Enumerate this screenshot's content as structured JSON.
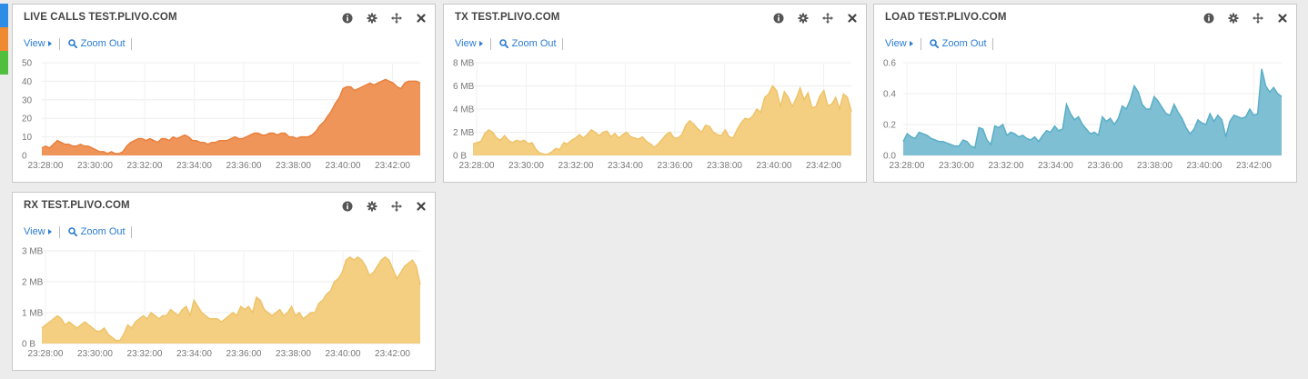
{
  "side_tabs": [
    {
      "name": "tab-blue",
      "color": "#2d8ce6"
    },
    {
      "name": "tab-orange",
      "color": "#f08a30"
    },
    {
      "name": "tab-green",
      "color": "#4fbf3d"
    }
  ],
  "toolbar": {
    "view_label": "View",
    "zoom_label": "Zoom Out"
  },
  "panels": {
    "live_calls": {
      "title": "LIVE CALLS TEST.PLIVO.COM",
      "chart_data": {
        "type": "area",
        "color": "#f0955a",
        "stroke": "#e8803c",
        "x_ticks": [
          "23:28:00",
          "23:30:00",
          "23:32:00",
          "23:34:00",
          "23:36:00",
          "23:38:00",
          "23:40:00",
          "23:42:00"
        ],
        "y_ticks": [
          "0",
          "10",
          "20",
          "30",
          "40",
          "50"
        ],
        "ylim": [
          0,
          50
        ],
        "values": [
          4,
          5,
          4,
          6,
          8,
          7,
          6,
          6,
          5,
          5,
          6,
          5,
          5,
          4,
          3,
          2,
          2,
          1,
          2,
          1,
          1,
          2,
          5,
          7,
          8,
          9,
          9,
          8,
          9,
          8,
          7,
          9,
          9,
          8,
          10,
          9,
          10,
          11,
          10,
          8,
          8,
          7,
          7,
          6,
          7,
          7,
          8,
          8,
          8,
          9,
          10,
          9,
          9,
          10,
          11,
          12,
          12,
          11,
          11,
          12,
          12,
          11,
          12,
          12,
          10,
          10,
          9,
          10,
          10,
          10,
          11,
          13,
          16,
          18,
          21,
          24,
          28,
          31,
          36,
          37,
          37,
          35,
          36,
          37,
          38,
          39,
          38,
          39,
          40,
          41,
          40,
          39,
          37,
          36,
          39,
          40,
          40,
          40,
          39
        ]
      }
    },
    "tx": {
      "title": "TX TEST.PLIVO.COM",
      "chart_data": {
        "type": "area",
        "color": "#f4cf82",
        "stroke": "#eec368",
        "x_ticks": [
          "23:28:00",
          "23:30:00",
          "23:32:00",
          "23:34:00",
          "23:36:00",
          "23:38:00",
          "23:40:00",
          "23:42:00"
        ],
        "y_ticks": [
          "0 B",
          "2 MB",
          "4 MB",
          "6 MB",
          "8 MB"
        ],
        "ylim": [
          0,
          8
        ],
        "values": [
          1.0,
          1.1,
          1.2,
          1.9,
          2.2,
          2.0,
          1.5,
          1.3,
          1.7,
          1.3,
          1.1,
          1.3,
          1.2,
          1.3,
          1.0,
          1.1,
          0.5,
          0.2,
          0.1,
          0.1,
          0.3,
          0.6,
          0.5,
          1.1,
          1.0,
          1.3,
          1.5,
          1.8,
          1.5,
          1.8,
          2.2,
          2.0,
          1.7,
          2.0,
          2.1,
          1.6,
          1.9,
          1.5,
          1.8,
          2.0,
          1.6,
          1.5,
          1.4,
          1.6,
          1.2,
          1.0,
          0.7,
          1.0,
          1.4,
          1.8,
          2.0,
          1.5,
          1.5,
          1.8,
          2.6,
          3.0,
          2.7,
          2.3,
          2.0,
          2.6,
          2.5,
          2.0,
          1.8,
          1.7,
          2.2,
          1.6,
          1.5,
          2.2,
          2.8,
          3.2,
          3.1,
          3.4,
          4.0,
          3.7,
          5.0,
          5.3,
          6.0,
          5.6,
          4.2,
          5.5,
          5.0,
          4.2,
          4.9,
          5.8,
          4.8,
          5.4,
          4.1,
          4.2,
          5.1,
          5.6,
          4.3,
          4.4,
          5.0,
          4.0,
          5.3,
          5.0,
          3.8
        ]
      }
    },
    "load": {
      "title": "LOAD TEST.PLIVO.COM",
      "chart_data": {
        "type": "area",
        "color": "#7ebfd3",
        "stroke": "#5aaec7",
        "x_ticks": [
          "23:28:00",
          "23:30:00",
          "23:32:00",
          "23:34:00",
          "23:36:00",
          "23:38:00",
          "23:40:00",
          "23:42:00"
        ],
        "y_ticks": [
          "0.0",
          "0.2",
          "0.4",
          "0.6"
        ],
        "ylim": [
          0,
          0.6
        ],
        "values": [
          0.09,
          0.14,
          0.12,
          0.11,
          0.15,
          0.14,
          0.13,
          0.11,
          0.1,
          0.09,
          0.09,
          0.08,
          0.07,
          0.06,
          0.06,
          0.1,
          0.09,
          0.06,
          0.05,
          0.18,
          0.17,
          0.1,
          0.07,
          0.19,
          0.18,
          0.2,
          0.13,
          0.15,
          0.14,
          0.12,
          0.13,
          0.11,
          0.1,
          0.12,
          0.09,
          0.13,
          0.16,
          0.15,
          0.19,
          0.16,
          0.17,
          0.33,
          0.27,
          0.23,
          0.25,
          0.2,
          0.17,
          0.14,
          0.15,
          0.13,
          0.25,
          0.22,
          0.24,
          0.2,
          0.24,
          0.32,
          0.3,
          0.36,
          0.45,
          0.41,
          0.33,
          0.3,
          0.3,
          0.38,
          0.35,
          0.31,
          0.27,
          0.26,
          0.33,
          0.28,
          0.24,
          0.18,
          0.14,
          0.17,
          0.23,
          0.21,
          0.2,
          0.27,
          0.22,
          0.26,
          0.23,
          0.12,
          0.22,
          0.26,
          0.25,
          0.24,
          0.25,
          0.3,
          0.26,
          0.27,
          0.56,
          0.45,
          0.41,
          0.44,
          0.4,
          0.38
        ]
      }
    },
    "rx": {
      "title": "RX TEST.PLIVO.COM",
      "chart_data": {
        "type": "area",
        "color": "#f4cf82",
        "stroke": "#eec368",
        "x_ticks": [
          "23:28:00",
          "23:30:00",
          "23:32:00",
          "23:34:00",
          "23:36:00",
          "23:38:00",
          "23:40:00",
          "23:42:00"
        ],
        "y_ticks": [
          "0 B",
          "1 MB",
          "2 MB",
          "3 MB"
        ],
        "ylim": [
          0,
          3
        ],
        "values": [
          0.5,
          0.6,
          0.7,
          0.8,
          0.9,
          0.8,
          0.6,
          0.7,
          0.6,
          0.5,
          0.6,
          0.7,
          0.6,
          0.5,
          0.4,
          0.4,
          0.5,
          0.3,
          0.2,
          0.1,
          0.1,
          0.3,
          0.6,
          0.5,
          0.7,
          0.8,
          0.9,
          0.8,
          1.0,
          0.9,
          0.8,
          0.9,
          0.9,
          1.1,
          1.0,
          0.9,
          1.1,
          1.2,
          0.9,
          1.4,
          1.2,
          1.0,
          0.9,
          0.8,
          0.8,
          0.8,
          0.7,
          0.8,
          0.9,
          1.0,
          0.9,
          1.2,
          1.1,
          1.2,
          1.0,
          1.5,
          1.4,
          1.1,
          1.0,
          0.9,
          1.0,
          1.1,
          0.9,
          1.0,
          1.2,
          0.9,
          1.0,
          0.8,
          0.9,
          1.0,
          1.0,
          1.3,
          1.4,
          1.6,
          1.7,
          2.0,
          2.1,
          2.3,
          2.7,
          2.8,
          2.7,
          2.8,
          2.7,
          2.5,
          2.2,
          2.3,
          2.5,
          2.7,
          2.8,
          2.7,
          2.4,
          2.1,
          2.3,
          2.5,
          2.6,
          2.7,
          2.5,
          1.9
        ]
      }
    }
  }
}
